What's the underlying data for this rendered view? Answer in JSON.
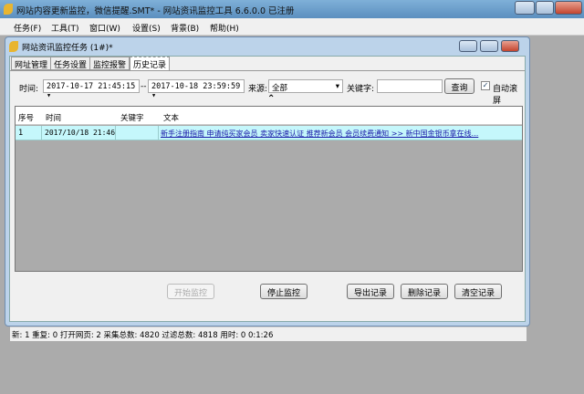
{
  "app": {
    "title": "网站内容更新监控，微信提醒.SMT* - 网站资讯监控工具 6.6.0.0  已注册"
  },
  "menu": [
    "任务(F)",
    "工具(T)",
    "窗口(W)",
    "设置(S)",
    "背景(B)",
    "帮助(H)"
  ],
  "child": {
    "title": "网站资讯监控任务  (1#)*",
    "tabs": [
      "网址管理",
      "任务设置",
      "监控报警",
      "历史记录"
    ],
    "filter": {
      "time_label": "时间:",
      "from": "2017-10-17 21:45:15",
      "sep": "--",
      "to": "2017-10-18 23:59:59",
      "source_label": "来源:",
      "source_value": "全部",
      "keyword_label": "关键字:",
      "keyword_value": "",
      "query": "查询",
      "autoscroll": "自动滚屏"
    },
    "table": {
      "headers": [
        "序号",
        "时间",
        "关键字",
        "文本"
      ],
      "rows": [
        {
          "no": "1",
          "time": "2017/10/18 21:46",
          "keyword": "",
          "text": "新手注册指南  申请纯买家会员  卖家快速认证  推荐新会员  会员续费通知  >>  新中国金银币拿在线..."
        }
      ]
    },
    "buttons": {
      "start": "开始监控",
      "stop": "停止监控",
      "export": "导出记录",
      "delete": "删除记录",
      "clear": "清空记录"
    },
    "status": "新: 1  重复: 0  打开网页: 2  采集总数: 4820  过滤总数: 4818  用时: 0 0:1:26"
  }
}
